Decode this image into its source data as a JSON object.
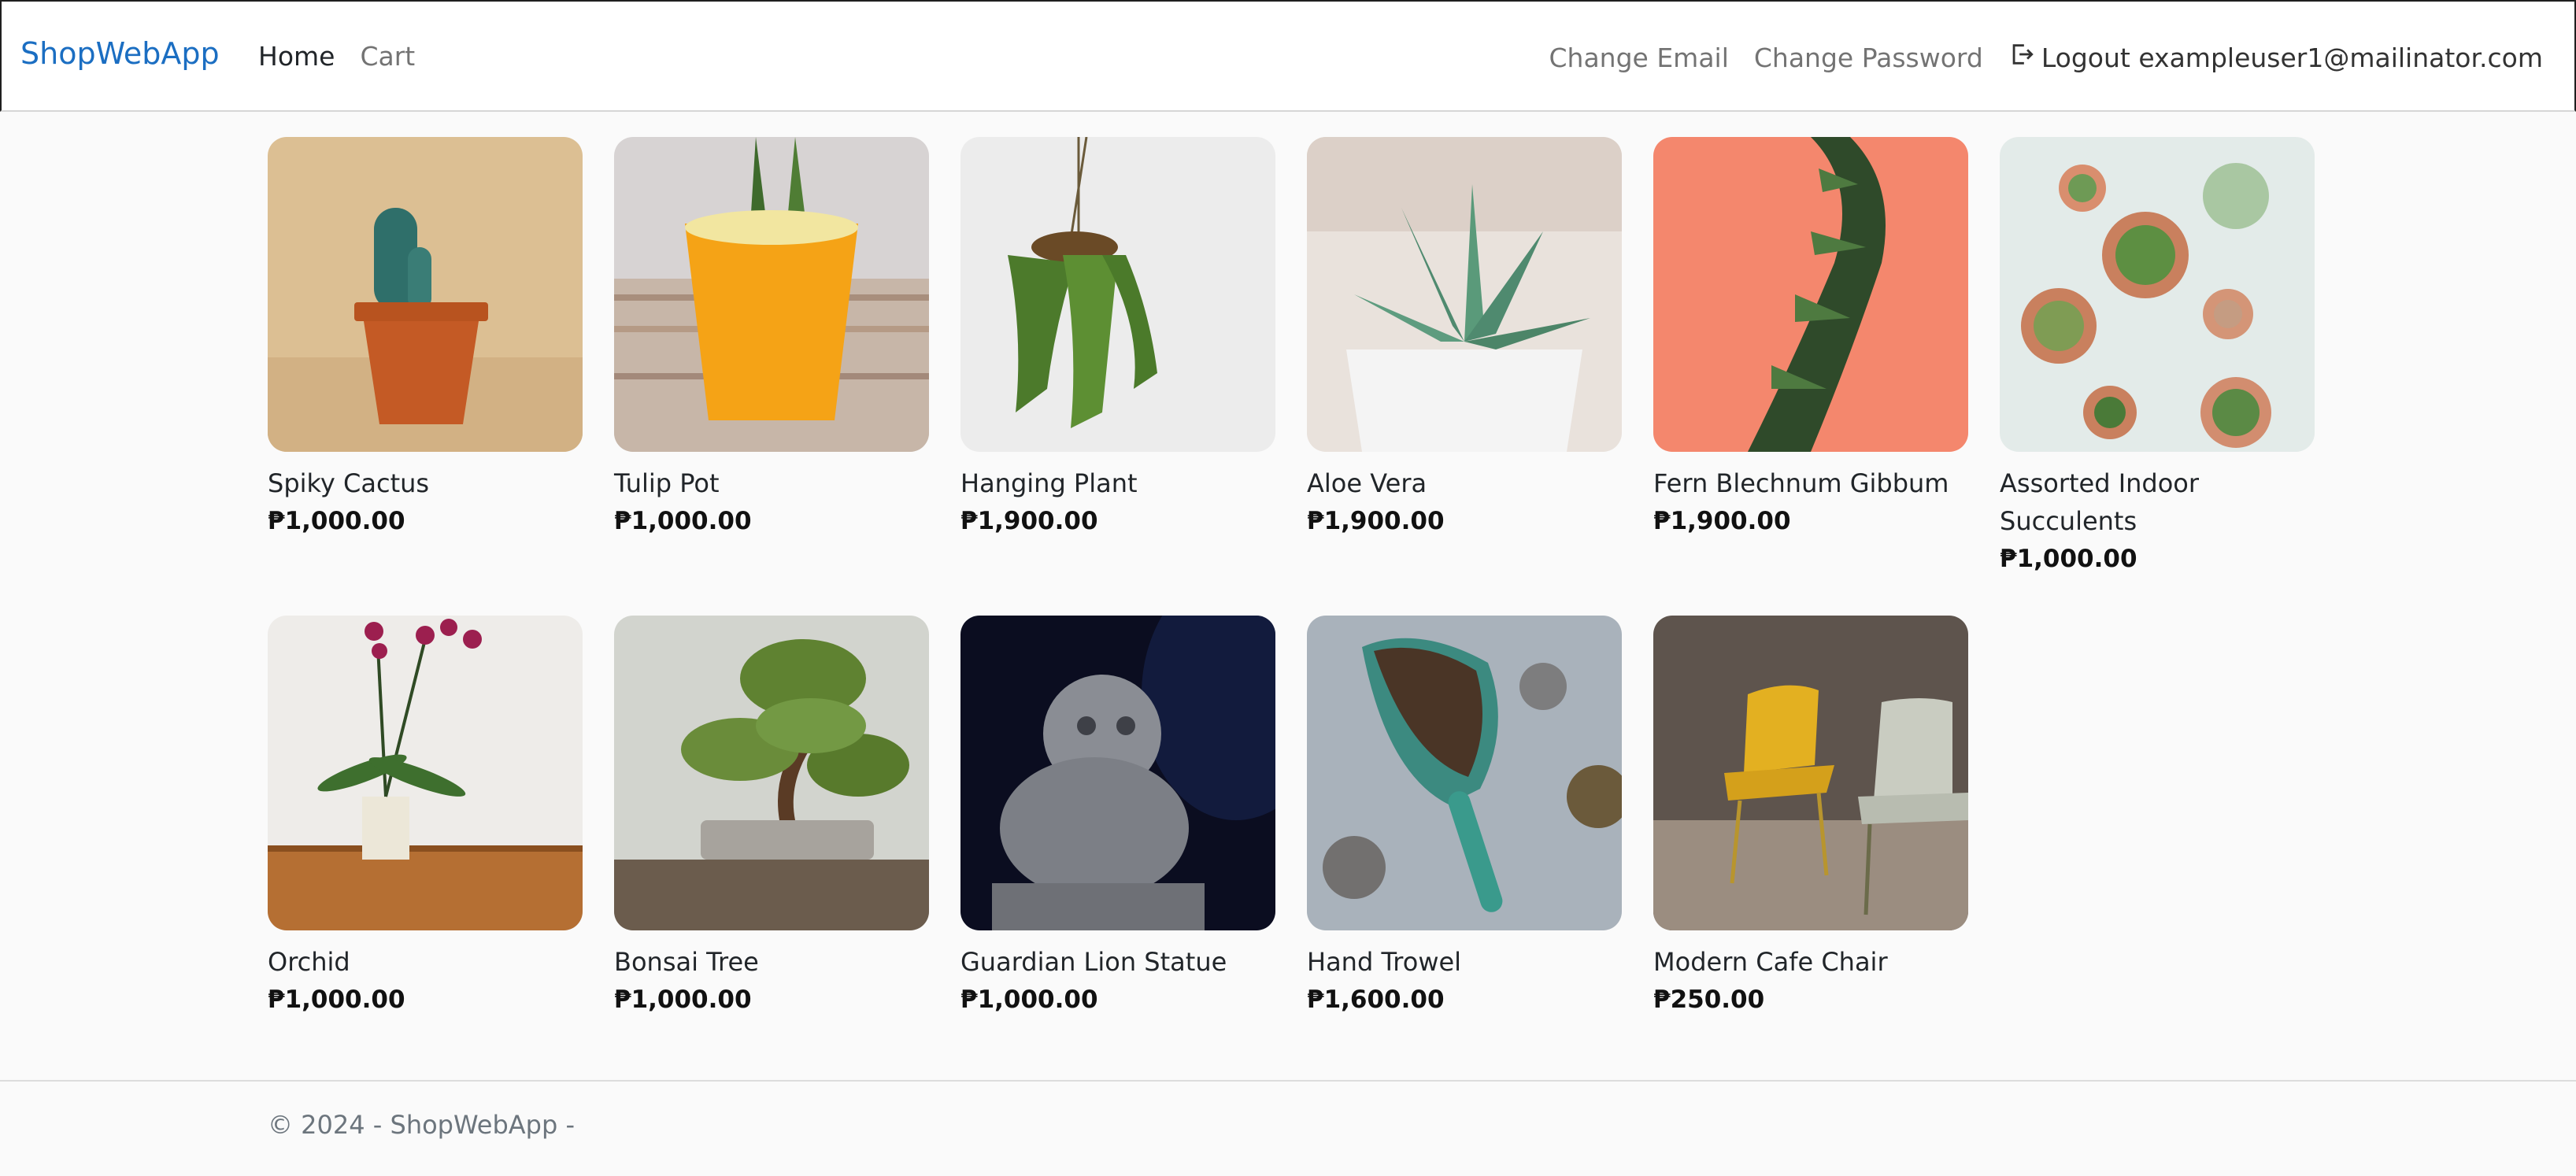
{
  "nav": {
    "brand": "ShopWebApp",
    "links": [
      {
        "label": "Home",
        "active": true
      },
      {
        "label": "Cart",
        "active": false
      }
    ],
    "right": {
      "change_email": "Change Email",
      "change_password": "Change Password",
      "logout": "Logout exampleuser1@mailinator.com"
    }
  },
  "products": [
    {
      "name": "Spiky Cactus",
      "price": "₱1,000.00",
      "image_icon": "cactus-icon"
    },
    {
      "name": "Tulip Pot",
      "price": "₱1,000.00",
      "image_icon": "tulip-pot-icon"
    },
    {
      "name": "Hanging Plant",
      "price": "₱1,900.00",
      "image_icon": "hanging-plant-icon"
    },
    {
      "name": "Aloe Vera",
      "price": "₱1,900.00",
      "image_icon": "aloe-icon"
    },
    {
      "name": "Fern Blechnum Gibbum",
      "price": "₱1,900.00",
      "image_icon": "fern-icon"
    },
    {
      "name": "Assorted Indoor Succulents",
      "price": "₱1,000.00",
      "image_icon": "succulents-icon"
    },
    {
      "name": "Orchid",
      "price": "₱1,000.00",
      "image_icon": "orchid-icon"
    },
    {
      "name": "Bonsai Tree",
      "price": "₱1,000.00",
      "image_icon": "bonsai-icon"
    },
    {
      "name": "Guardian Lion Statue",
      "price": "₱1,000.00",
      "image_icon": "lion-statue-icon"
    },
    {
      "name": "Hand Trowel",
      "price": "₱1,600.00",
      "image_icon": "trowel-icon"
    },
    {
      "name": "Modern Cafe Chair",
      "price": "₱250.00",
      "image_icon": "chair-icon"
    }
  ],
  "footer": {
    "text": "© 2024 - ShopWebApp -"
  },
  "colors": {
    "brand": "#1b6ec2",
    "background": "#fafafa"
  }
}
